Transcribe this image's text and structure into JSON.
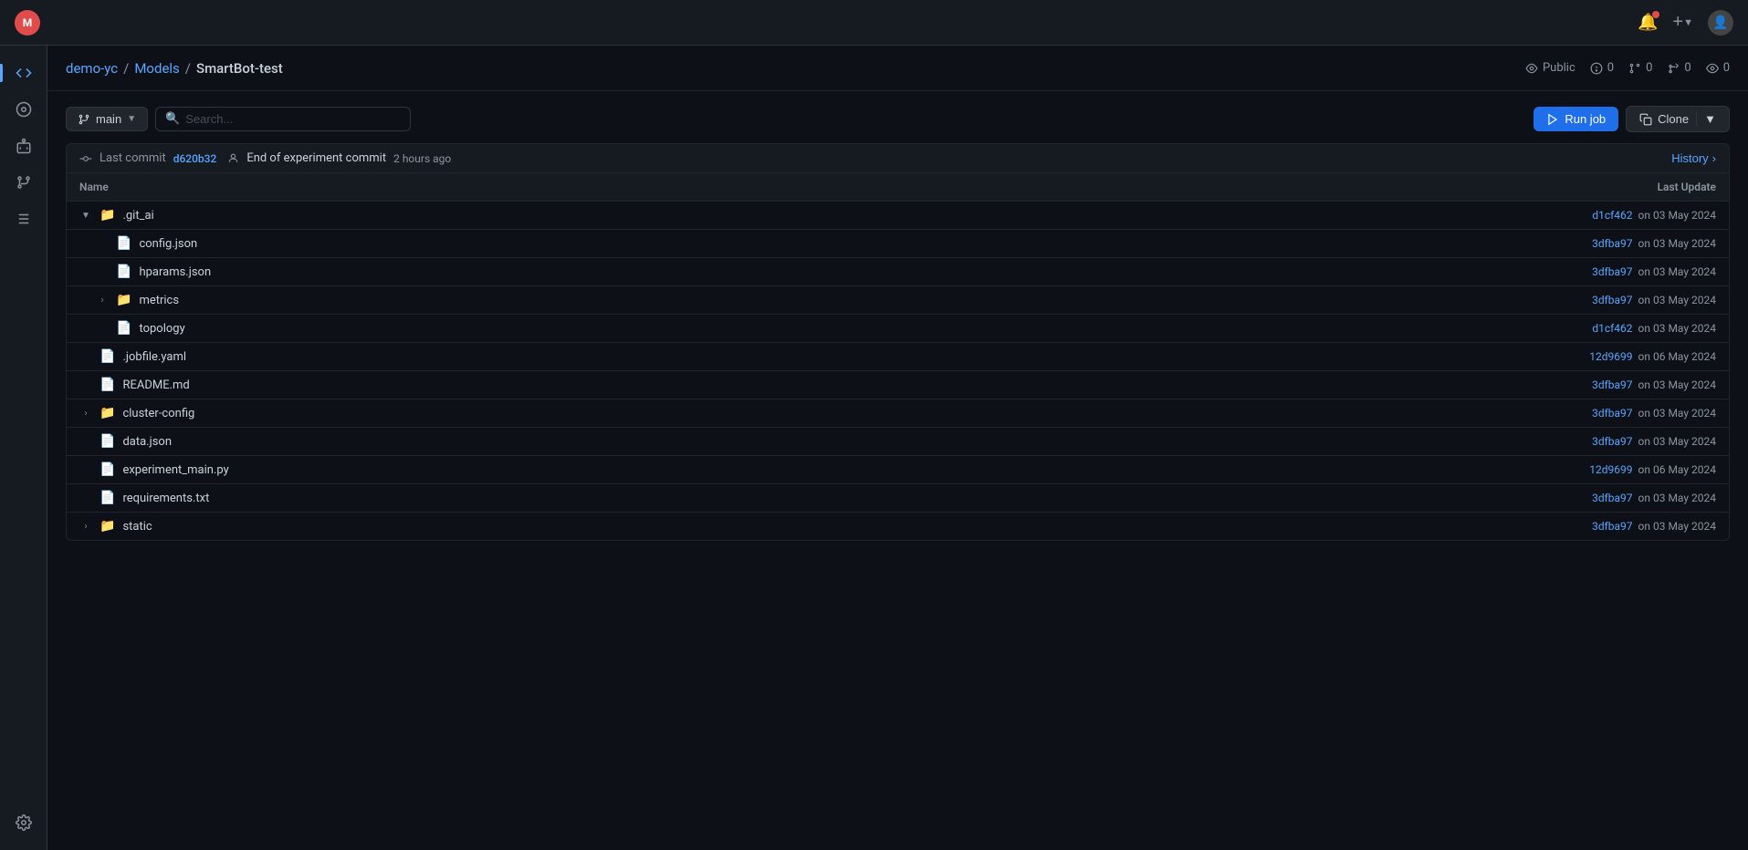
{
  "app": {
    "logo_text": "M"
  },
  "topbar": {
    "notification_icon": "🔔",
    "plus_icon": "+",
    "user_icon": "👤"
  },
  "breadcrumb": {
    "org": "demo-yc",
    "sep1": "/",
    "repo": "Models",
    "sep2": "/",
    "current": "SmartBot-test"
  },
  "meta": {
    "visibility": "Public",
    "issues_count": "0",
    "prs_count": "0",
    "forks_count": "0",
    "watchers_count": "0"
  },
  "sidebar": {
    "items": [
      {
        "name": "code-icon",
        "icon": "⌥",
        "label": "Code",
        "active": true
      },
      {
        "name": "explore-icon",
        "icon": "◎",
        "label": "Explore",
        "active": false
      },
      {
        "name": "bot-icon",
        "icon": "⚡",
        "label": "Bot",
        "active": false
      },
      {
        "name": "pr-icon",
        "icon": "⑂",
        "label": "Pull Requests",
        "active": false
      },
      {
        "name": "pipeline-icon",
        "icon": "▶",
        "label": "Pipelines",
        "active": false
      },
      {
        "name": "settings-icon",
        "icon": "⚙",
        "label": "Settings",
        "active": false
      }
    ]
  },
  "toolbar": {
    "branch_label": "main",
    "search_placeholder": "Search...",
    "run_job_label": "Run job",
    "clone_label": "Clone"
  },
  "commit": {
    "last_commit_label": "Last commit",
    "hash": "d620b32",
    "message": "End of experiment commit",
    "time": "2 hours ago",
    "history_label": "History"
  },
  "table": {
    "name_header": "Name",
    "last_update_header": "Last Update",
    "rows": [
      {
        "type": "folder",
        "name": ".git_ai",
        "expanded": true,
        "indent": 0,
        "hash": "d1cf462",
        "date": "on 03 May 2024"
      },
      {
        "type": "file",
        "name": "config.json",
        "indent": 1,
        "hash": "3dfba97",
        "date": "on 03 May 2024"
      },
      {
        "type": "file",
        "name": "hparams.json",
        "indent": 1,
        "hash": "3dfba97",
        "date": "on 03 May 2024"
      },
      {
        "type": "folder",
        "name": "metrics",
        "expanded": false,
        "indent": 1,
        "hash": "3dfba97",
        "date": "on 03 May 2024"
      },
      {
        "type": "file",
        "name": "topology",
        "indent": 1,
        "hash": "d1cf462",
        "date": "on 03 May 2024"
      },
      {
        "type": "file",
        "name": ".jobfile.yaml",
        "indent": 0,
        "hash": "12d9699",
        "date": "on 06 May 2024"
      },
      {
        "type": "file",
        "name": "README.md",
        "indent": 0,
        "hash": "3dfba97",
        "date": "on 03 May 2024"
      },
      {
        "type": "folder",
        "name": "cluster-config",
        "expanded": false,
        "indent": 0,
        "hash": "3dfba97",
        "date": "on 03 May 2024"
      },
      {
        "type": "file",
        "name": "data.json",
        "indent": 0,
        "hash": "3dfba97",
        "date": "on 03 May 2024"
      },
      {
        "type": "file",
        "name": "experiment_main.py",
        "indent": 0,
        "hash": "12d9699",
        "date": "on 06 May 2024"
      },
      {
        "type": "file",
        "name": "requirements.txt",
        "indent": 0,
        "hash": "3dfba97",
        "date": "on 03 May 2024"
      },
      {
        "type": "folder",
        "name": "static",
        "expanded": false,
        "indent": 0,
        "hash": "3dfba97",
        "date": "on 03 May 2024"
      }
    ]
  }
}
